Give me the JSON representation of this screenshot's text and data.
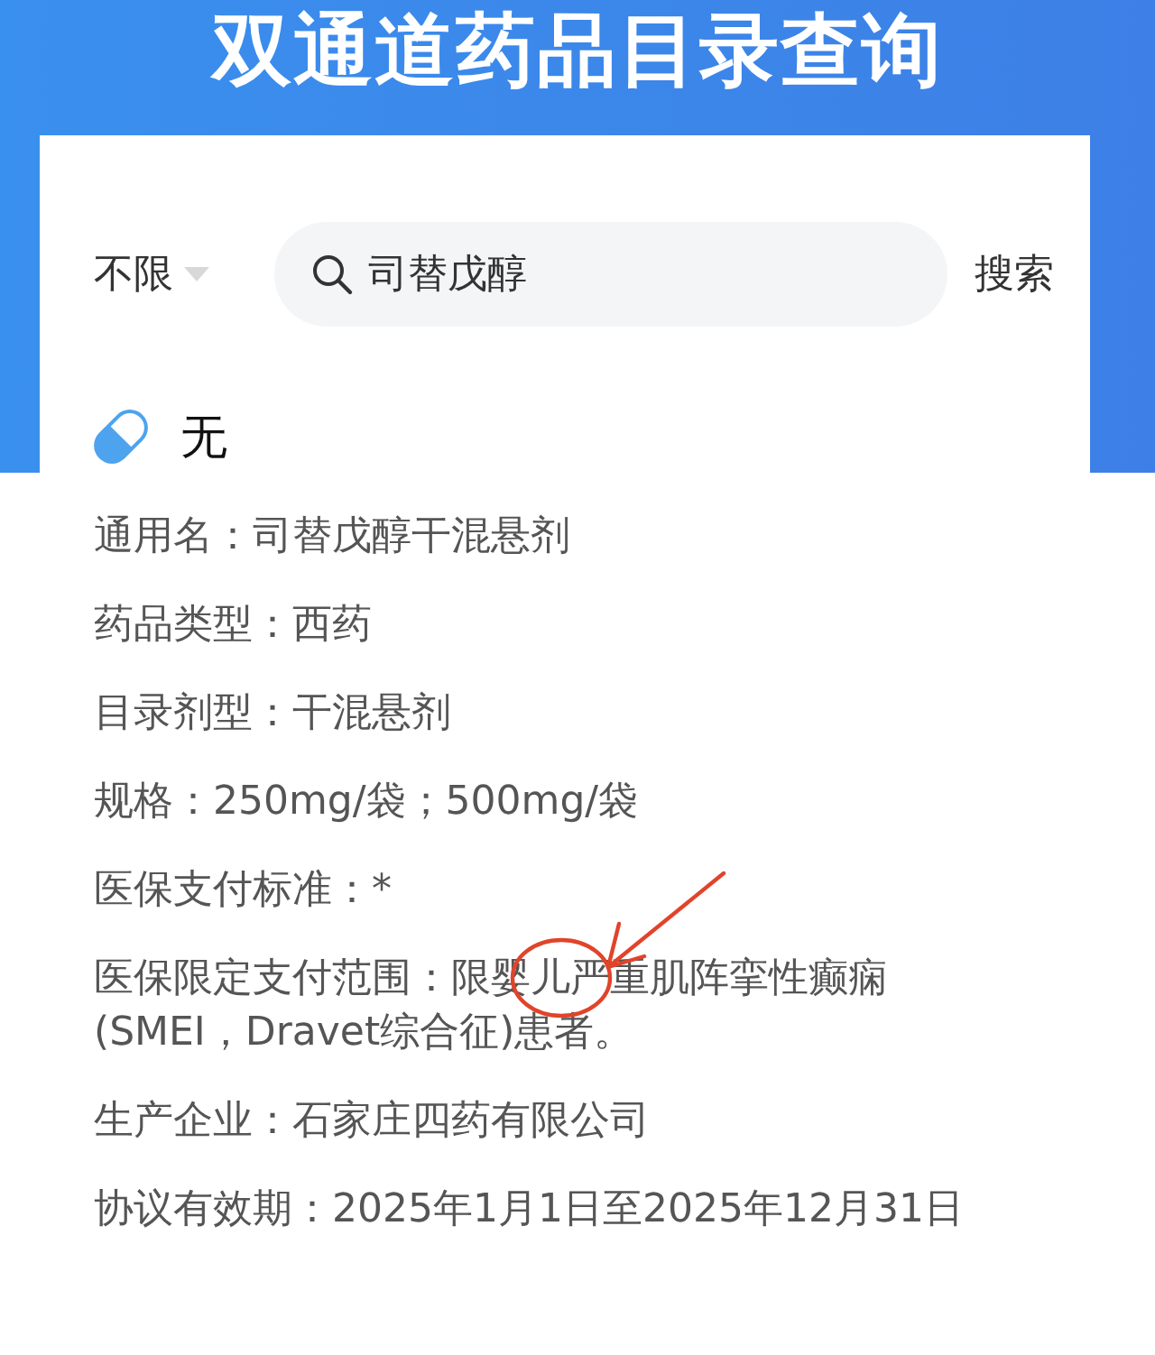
{
  "title": "双通道药品目录查询",
  "filter": {
    "label": "不限"
  },
  "search": {
    "value": "司替戊醇",
    "button": "搜索"
  },
  "result": {
    "name": "无"
  },
  "fields": [
    {
      "text": "通用名：司替戊醇干混悬剂",
      "annotated": false
    },
    {
      "text": "药品类型：西药",
      "annotated": false
    },
    {
      "text": "目录剂型：干混悬剂",
      "annotated": false
    },
    {
      "text": "规格：250mg/袋；500mg/袋",
      "annotated": false
    },
    {
      "text": "医保支付标准：*",
      "annotated": false
    },
    {
      "text": "医保限定支付范围：限婴儿严重肌阵挛性癫痫(SMEI，Dravet综合征)患者。",
      "annotated": true
    },
    {
      "text": "生产企业：石家庄四药有限公司",
      "annotated": false
    },
    {
      "text": "协议有效期：2025年1月1日至2025年12月31日",
      "annotated": false
    }
  ]
}
